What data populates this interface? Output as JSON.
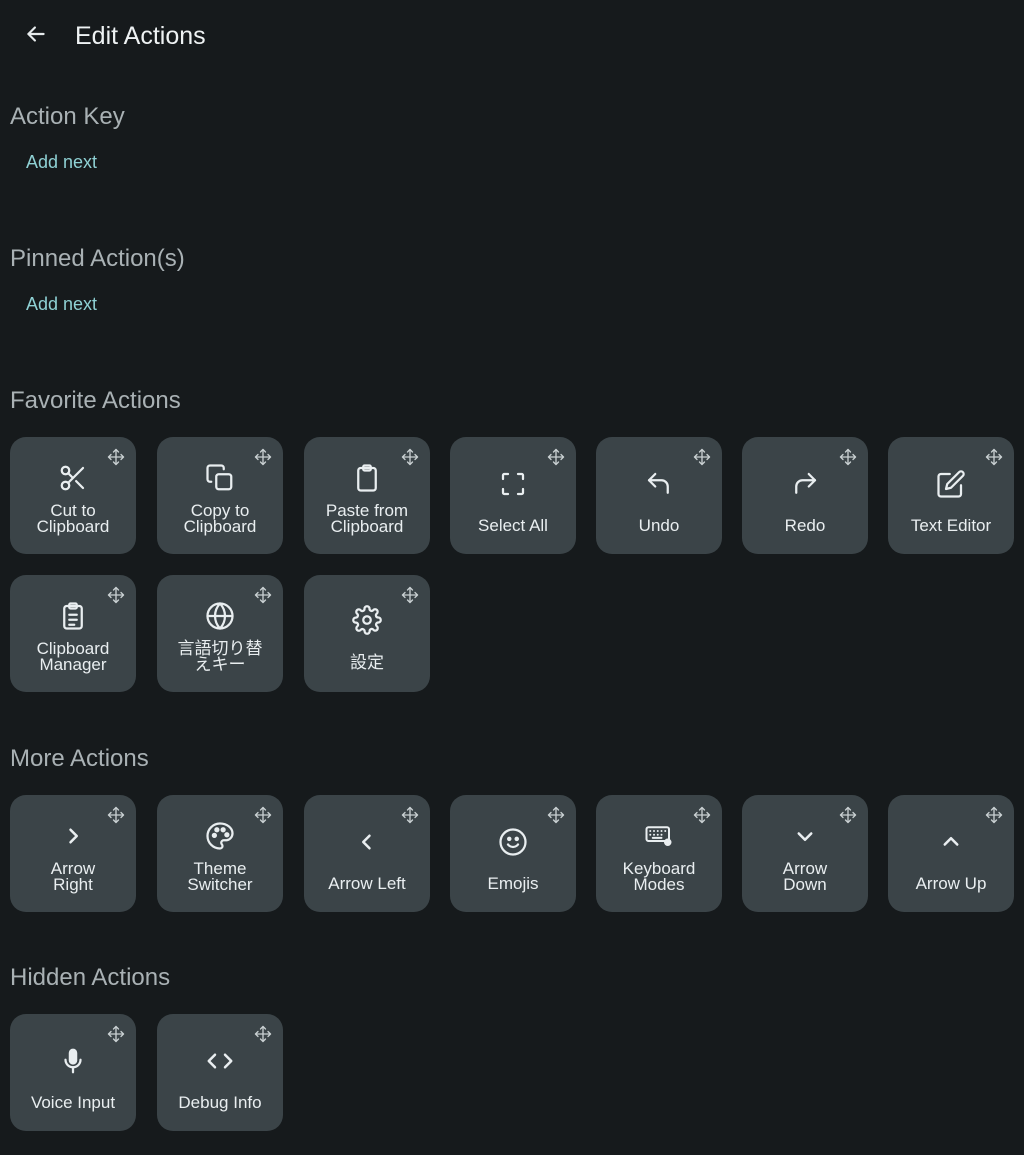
{
  "header": {
    "title": "Edit Actions"
  },
  "sections": {
    "action_key": {
      "title": "Action Key",
      "add_label": "Add next"
    },
    "pinned": {
      "title": "Pinned Action(s)",
      "add_label": "Add next"
    },
    "favorite": {
      "title": "Favorite Actions",
      "items": [
        {
          "label": "Cut to\nClipboard",
          "icon": "scissors-icon"
        },
        {
          "label": "Copy to\nClipboard",
          "icon": "copy-icon"
        },
        {
          "label": "Paste from\nClipboard",
          "icon": "clipboard-icon"
        },
        {
          "label": "Select All",
          "icon": "select-all-icon"
        },
        {
          "label": "Undo",
          "icon": "undo-icon"
        },
        {
          "label": "Redo",
          "icon": "redo-icon"
        },
        {
          "label": "Text Editor",
          "icon": "edit-icon"
        },
        {
          "label": "Clipboard\nManager",
          "icon": "clipboard-list-icon"
        },
        {
          "label": "言語切り替\nえキー",
          "icon": "globe-icon"
        },
        {
          "label": "設定",
          "icon": "gear-icon"
        }
      ]
    },
    "more": {
      "title": "More Actions",
      "items": [
        {
          "label": "Arrow\nRight",
          "icon": "chevron-right-icon"
        },
        {
          "label": "Theme\nSwitcher",
          "icon": "palette-icon"
        },
        {
          "label": "Arrow Left",
          "icon": "chevron-left-icon"
        },
        {
          "label": "Emojis",
          "icon": "smiley-icon"
        },
        {
          "label": "Keyboard\nModes",
          "icon": "keyboard-settings-icon"
        },
        {
          "label": "Arrow\nDown",
          "icon": "chevron-down-icon"
        },
        {
          "label": "Arrow Up",
          "icon": "chevron-up-icon"
        }
      ]
    },
    "hidden": {
      "title": "Hidden Actions",
      "items": [
        {
          "label": "Voice Input",
          "icon": "microphone-icon"
        },
        {
          "label": "Debug Info",
          "icon": "code-icon"
        }
      ]
    }
  },
  "colors": {
    "background": "#161a1c",
    "tile": "#3b4448",
    "accent": "#8fd1d4",
    "section_title": "#a9b1b4"
  }
}
